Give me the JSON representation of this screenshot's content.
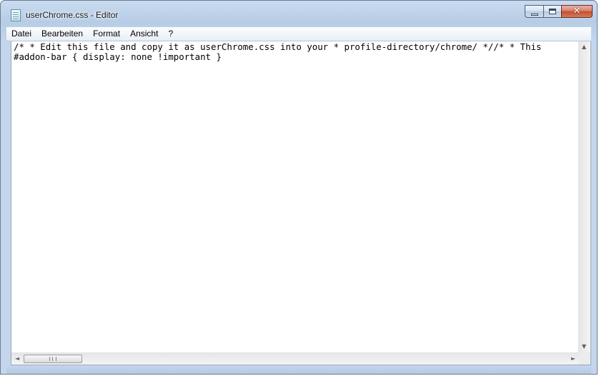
{
  "window": {
    "title": "userChrome.css - Editor",
    "icon": "notepad-icon",
    "controls": {
      "minimize_icon": "minimize-icon",
      "maximize_icon": "maximize-icon",
      "close_glyph": "✕"
    }
  },
  "menubar": {
    "items": [
      "Datei",
      "Bearbeiten",
      "Format",
      "Ansicht",
      "?"
    ]
  },
  "editor": {
    "lines": [
      "/* * Edit this file and copy it as userChrome.css into your * profile-directory/chrome/ *//* * This",
      "#addon-bar { display: none !important }"
    ]
  },
  "scrollbars": {
    "up_arrow": "▲",
    "down_arrow": "▼",
    "left_arrow": "◄",
    "right_arrow": "►"
  },
  "colors": {
    "frame": "#b7cde6",
    "close_button": "#c24e35"
  }
}
